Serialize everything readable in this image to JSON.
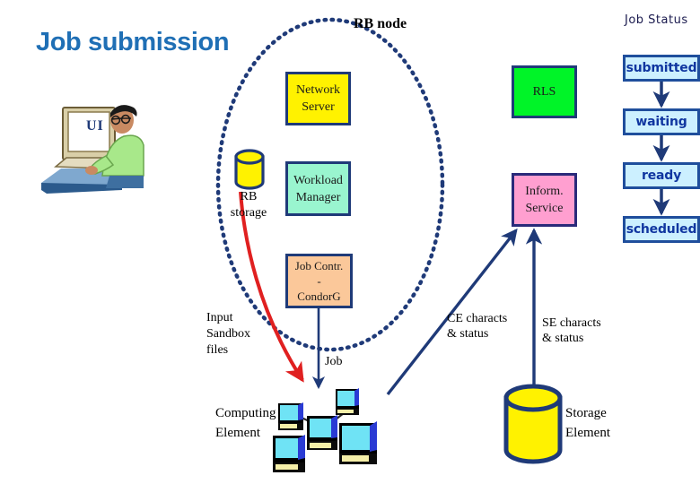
{
  "slide": {
    "title": "Job submission",
    "rb_node_label": "RB node",
    "job_status_title": "Job Status"
  },
  "colors": {
    "title_blue": "#1F6FB5",
    "navy": "#1F3A78",
    "network_server_bg": "#FFF200",
    "workload_manager_bg": "#99F5CF",
    "job_controller_bg": "#FBC89A",
    "rls_bg": "#00F428",
    "inform_service_bg": "#FF9FD0",
    "status_bg": "#CCF0FF",
    "status_text": "#1036A0",
    "red_arrow": "#E02020",
    "blue_arrow": "#1F3A78"
  },
  "rb_node": {
    "components": [
      {
        "id": "network-server",
        "label": "Network\nServer"
      },
      {
        "id": "workload-manager",
        "label": "Workload\nManager"
      },
      {
        "id": "job-controller",
        "label": "Job Contr.\n-\nCondorG"
      }
    ],
    "storage_label": "RB\nstorage"
  },
  "services": [
    {
      "id": "rls",
      "label": "RLS"
    },
    {
      "id": "inform-service",
      "label": "Inform.\nService"
    }
  ],
  "job_status": {
    "states": [
      {
        "label": "submitted"
      },
      {
        "label": "waiting"
      },
      {
        "label": "ready"
      },
      {
        "label": "scheduled"
      }
    ]
  },
  "annotations": {
    "ui_screen": "UI",
    "input_sandbox": "Input\nSandbox\nfiles",
    "job": "Job",
    "ce_characteristics": "CE characts\n& status",
    "se_characteristics": "SE characts\n& status",
    "computing_element": "Computing\nElement",
    "storage_element": "Storage\nElement"
  },
  "icons": {
    "rb_storage": "database-cylinder-icon",
    "storage_element": "database-cylinder-icon",
    "computing_element": "computer-cluster-icon",
    "user_interface": "person-at-computer-icon",
    "rb_node_boundary": "dashed-ellipse-icon"
  }
}
